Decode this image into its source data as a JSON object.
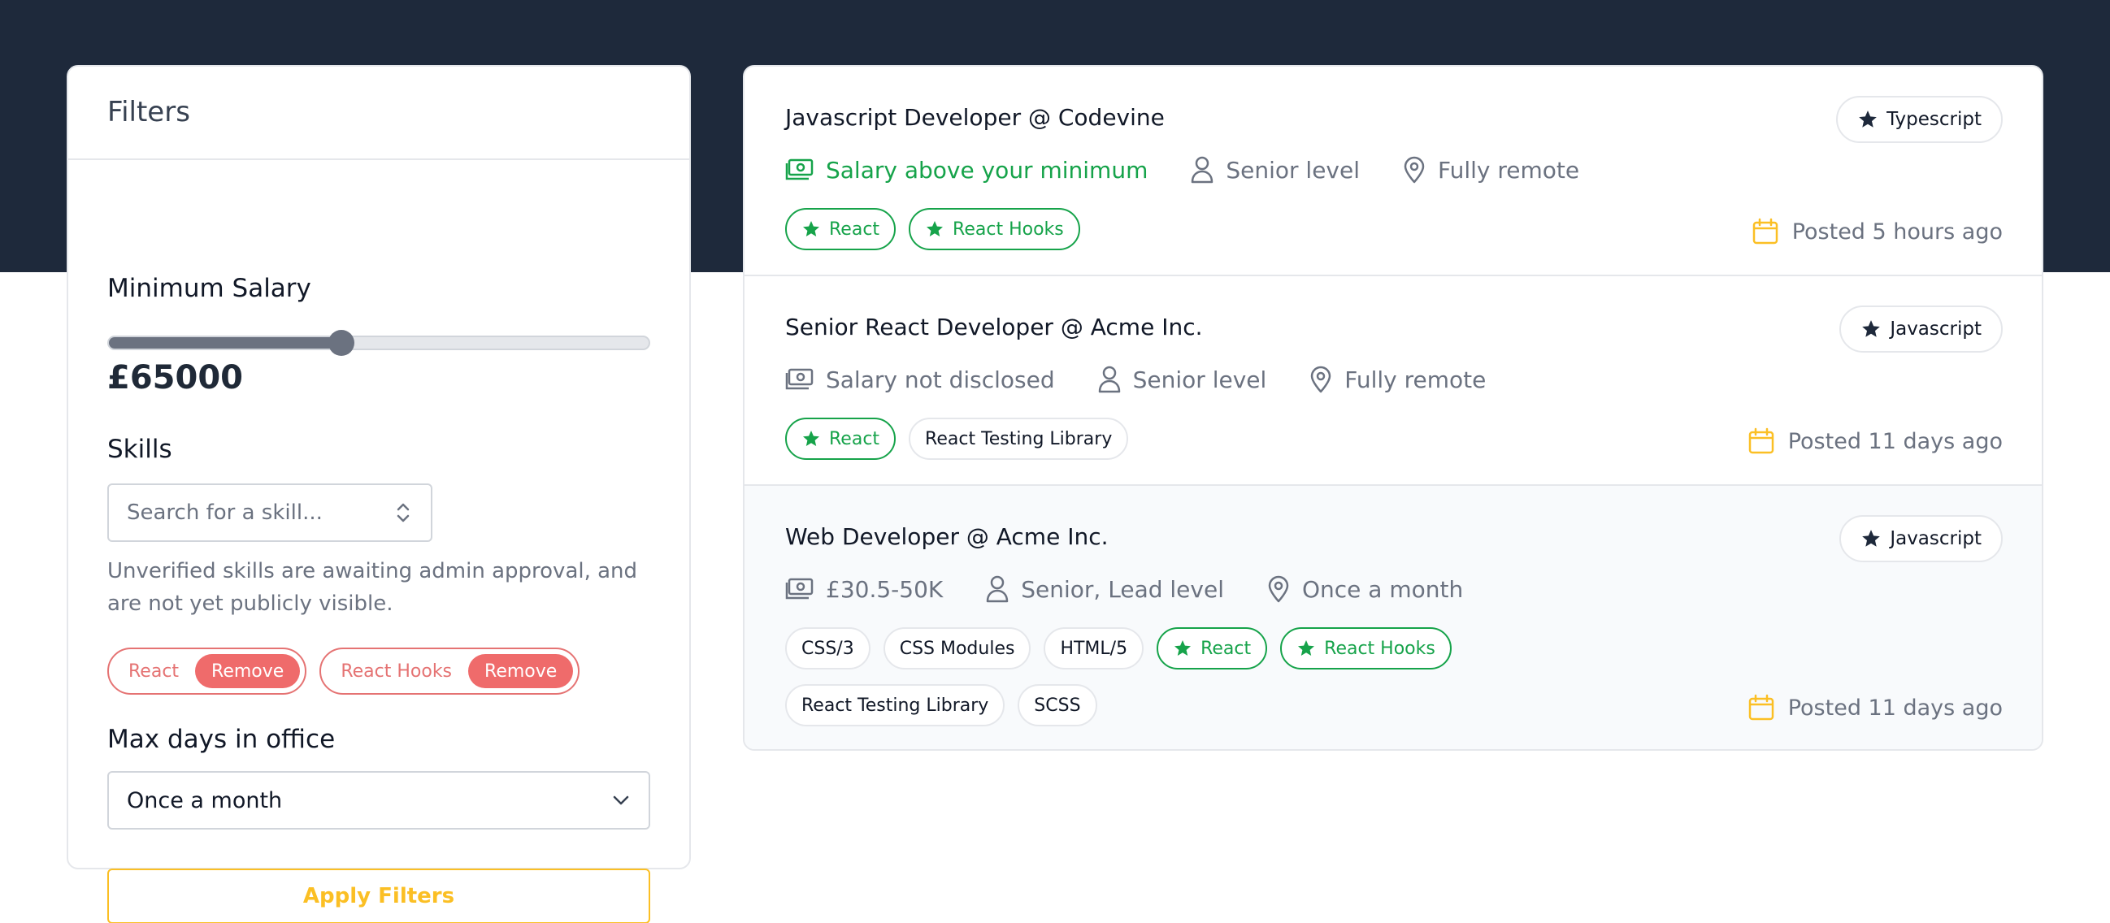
{
  "filters": {
    "title": "Filters",
    "min_salary_label": "Minimum Salary",
    "min_salary_value": "£65000",
    "min_salary_fraction": 0.43,
    "skills_label": "Skills",
    "skill_search_placeholder": "Search for a skill...",
    "skills_note": "Unverified skills are awaiting admin approval, and are not yet publicly visible.",
    "selected_skills": [
      {
        "label": "React",
        "remove_label": "Remove"
      },
      {
        "label": "React Hooks",
        "remove_label": "Remove"
      }
    ],
    "max_days_label": "Max days in office",
    "max_days_selected": "Once a month",
    "apply_label": "Apply Filters"
  },
  "jobs": [
    {
      "title": "Javascript Developer @ Codevine",
      "primary_skill": "Typescript",
      "salary": "Salary above your minimum",
      "level": "Senior level",
      "location": "Fully remote",
      "tags": [
        {
          "label": "React"
        },
        {
          "label": "React Hooks"
        }
      ],
      "posted": "Posted 5 hours ago"
    },
    {
      "title": "Senior React Developer @ Acme Inc.",
      "primary_skill": "Javascript",
      "salary": "Salary not disclosed",
      "level": "Senior level",
      "location": "Fully remote",
      "tags": [
        {
          "label": "React"
        },
        {
          "label": "React Testing Library"
        }
      ],
      "posted": "Posted 11 days ago"
    },
    {
      "title": "Web Developer @ Acme Inc.",
      "primary_skill": "Javascript",
      "salary": "£30.5-50K",
      "level": "Senior, Lead level",
      "location": "Once a month",
      "tags": [
        {
          "label": "CSS/3"
        },
        {
          "label": "CSS Modules"
        },
        {
          "label": "HTML/5"
        },
        {
          "label": "React"
        },
        {
          "label": "React Hooks"
        },
        {
          "label": "React Testing Library"
        },
        {
          "label": "SCSS"
        }
      ],
      "posted": "Posted 11 days ago"
    }
  ],
  "colors": {
    "header_band": "#1e293b",
    "favorite_green": "#16a34a",
    "remove_red": "#ef6b6b",
    "accent_yellow": "#fbbf24"
  },
  "icons": [
    "star-icon",
    "cash-icon",
    "user-icon",
    "location-pin-icon",
    "calendar-icon",
    "chevron-down-icon",
    "up-down-arrows-icon"
  ]
}
